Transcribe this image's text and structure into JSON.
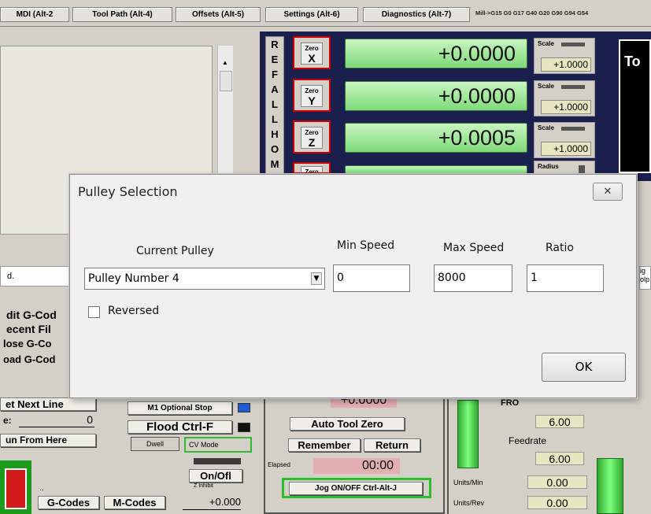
{
  "tabs": [
    "MDI (Alt-2",
    "Tool Path (Alt-4)",
    "Offsets (Alt-5)",
    "Settings (Alt-6)",
    "Diagnostics (Alt-7)"
  ],
  "modal_line": "Mill->G15  G0 G17 G40 G20 G90 G94 G54",
  "ref_all_home": [
    "R",
    "E",
    "F",
    "A",
    "L",
    "L",
    "H",
    "O",
    "M"
  ],
  "axes": [
    {
      "zero_label": "Zero",
      "axis": "X",
      "value": "+0.0000",
      "scale_label": "Scale",
      "scale_value": "+1.0000"
    },
    {
      "zero_label": "Zero",
      "axis": "Y",
      "value": "+0.0000",
      "scale_label": "Scale",
      "scale_value": "+1.0000"
    },
    {
      "zero_label": "Zero",
      "axis": "Z",
      "value": "+0.0005",
      "scale_label": "Scale",
      "scale_value": "+1.0000"
    }
  ],
  "fourth_zero_label": "Zero",
  "radius_label": "Radius",
  "tool_label": "To",
  "left_text": "d.",
  "file_menu": [
    "dit G-Cod",
    "ecent Fil",
    "lose G-Co",
    "oad G-Cod"
  ],
  "lower_left": {
    "set_next_line": "et Next Line",
    "line_label": "e:",
    "line_value": "0",
    "run_from_here": "un From Here",
    "m1_optional_stop": "M1 Optional Stop",
    "flood": "Flood Ctrl-F",
    "dwell": "Dwell",
    "cv_mode": "CV Mode",
    "on_off": "On/Ofl",
    "z_inhibit": "Z Inhibit",
    "z_inhibit_value": "+0.000",
    "dots": "..",
    "g_codes": "G-Codes",
    "m_codes": "M-Codes"
  },
  "center": {
    "partial_value": "+0.0000",
    "auto_tool_zero": "Auto Tool Zero",
    "remember": "Remember",
    "return": "Return",
    "elapsed_label": "Elapsed",
    "elapsed_value": "00:00",
    "jog": "Jog ON/OFF Ctrl-Alt-J"
  },
  "right": {
    "fro": "FRO",
    "fro_value": "6.00",
    "feedrate_label": "Feedrate",
    "feedrate_value": "6.00",
    "units_min_label": "Units/Min",
    "units_min_value": "0.00",
    "units_rev_label": "Units/Rev",
    "units_rev_value": "0.00",
    "edge_text": "ig\nolp"
  },
  "dialog": {
    "title": "Pulley Selection",
    "close": "✕",
    "current_pulley_label": "Current Pulley",
    "current_pulley_value": "Pulley Number 4",
    "min_speed_label": "Min Speed",
    "min_speed_value": "0",
    "max_speed_label": "Max Speed",
    "max_speed_value": "8000",
    "ratio_label": "Ratio",
    "ratio_value": "1",
    "reversed_label": "Reversed",
    "ok": "OK"
  }
}
